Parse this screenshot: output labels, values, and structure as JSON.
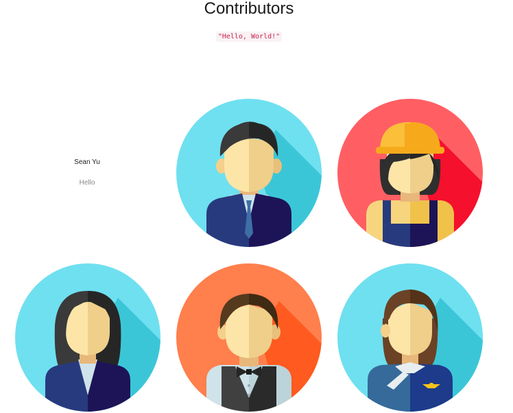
{
  "page": {
    "title": "Contributors",
    "code_snippet": "\"Hello, World!\""
  },
  "featured": {
    "name": "Sean Yu",
    "bio": "Hello"
  },
  "avatars": [
    {
      "icon": "businessman-avatar-icon",
      "bg": "#6fe0f0",
      "shadow": "#3bc6d8"
    },
    {
      "icon": "construction-worker-avatar-icon",
      "bg": "#ff5f63",
      "shadow": "#f5102d"
    },
    {
      "icon": "businesswoman-avatar-icon",
      "bg": "#6fe0f0",
      "shadow": "#3bc6d8"
    },
    {
      "icon": "waiter-avatar-icon",
      "bg": "#ff7f4d",
      "shadow": "#ff5a1f"
    },
    {
      "icon": "flight-attendant-avatar-icon",
      "bg": "#6fe0f0",
      "shadow": "#3bc6d8"
    }
  ]
}
